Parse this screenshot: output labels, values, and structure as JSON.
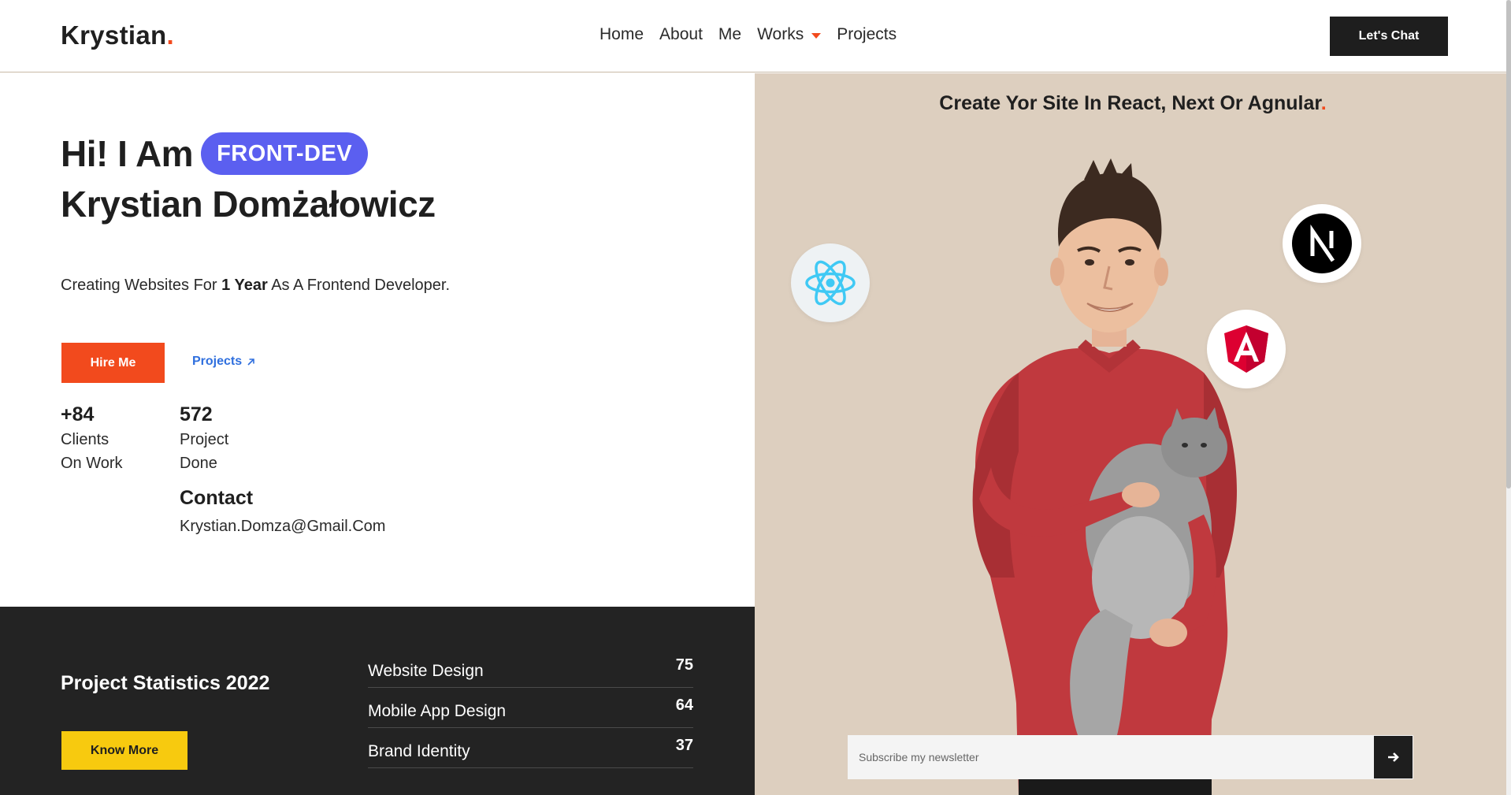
{
  "header": {
    "logo_text": "Krystian",
    "logo_dot": ".",
    "nav": [
      {
        "label": "Home"
      },
      {
        "label": "About"
      },
      {
        "label": "Me"
      },
      {
        "label": "Works"
      },
      {
        "label": "Projects"
      }
    ],
    "cta_label": "Let's Chat"
  },
  "hero": {
    "greeting": "Hi! I Am",
    "role_badge": "FRONT-DEV",
    "name": "Krystian Domżałowicz",
    "tagline_pre": "Creating Websites For ",
    "tagline_bold": "1 Year",
    "tagline_post": " As A Frontend Developer.",
    "hire_label": "Hire Me",
    "projects_label": "Projects",
    "projects_icon": "arrow-up-right-icon",
    "stats": [
      {
        "number": "+84",
        "label": "Clients On Work"
      },
      {
        "number": "572",
        "label": "Project Done"
      }
    ],
    "contact_title": "Contact",
    "contact_email": "Krystian.Domza@Gmail.Com"
  },
  "statistics": {
    "title": "Project Statistics 2022",
    "button_label": "Know More",
    "rows": [
      {
        "name": "Website Design",
        "value": "75"
      },
      {
        "name": "Mobile App Design",
        "value": "64"
      },
      {
        "name": "Brand Identity",
        "value": "37"
      }
    ]
  },
  "showcase": {
    "heading_pre": "Create Yor Site In ",
    "heading_bold1": "React, Next",
    "heading_mid": " Or ",
    "heading_bold2": "Agnular",
    "heading_dot": ".",
    "tech_icons": [
      "react-icon",
      "nextjs-icon",
      "angular-icon"
    ],
    "newsletter_placeholder": "Subscribe my newsletter",
    "submit_icon": "arrow-right-icon"
  },
  "colors": {
    "accent": "#f24a1d",
    "badge": "#5b5ff0",
    "dark": "#232323",
    "yellow": "#f7ca0f",
    "beige": "#ddcfbf",
    "link": "#2f6fde"
  }
}
